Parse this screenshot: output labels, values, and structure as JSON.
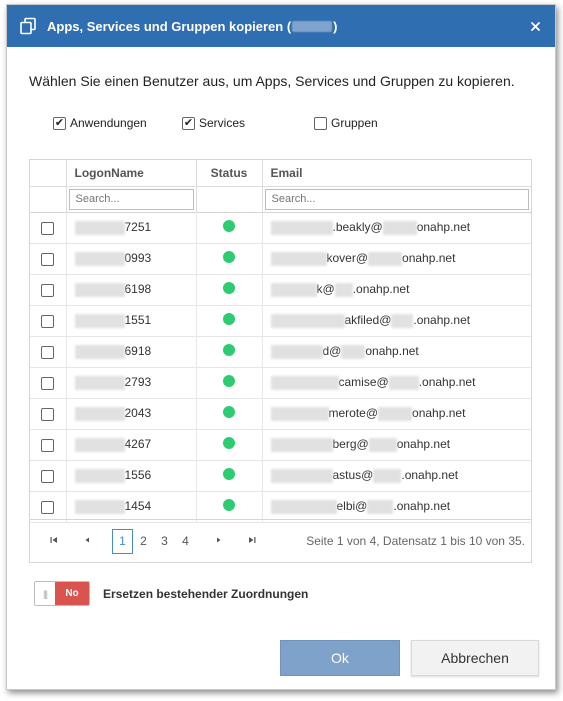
{
  "dialog": {
    "title": "Apps, Services und Gruppen kopieren (",
    "title_suffix": ")",
    "instruction": "Wählen Sie einen Benutzer aus, um Apps, Services und Gruppen zu kopieren."
  },
  "options": [
    {
      "label": "Anwendungen",
      "checked": true
    },
    {
      "label": "Services",
      "checked": true
    },
    {
      "label": "Gruppen",
      "checked": false
    }
  ],
  "grid": {
    "columns": [
      "LogonName",
      "Status",
      "Email"
    ],
    "search_placeholder": "Search...",
    "rows": [
      {
        "logon_suffix": "7251",
        "status": "green",
        "email_suffix": ".beakly@",
        "domain": "onahp.net"
      },
      {
        "logon_suffix": "0993",
        "status": "green",
        "email_suffix": "kover@",
        "domain": "onahp.net"
      },
      {
        "logon_suffix": "6198",
        "status": "green",
        "email_suffix": "k@",
        "domain": ".onahp.net"
      },
      {
        "logon_suffix": "1551",
        "status": "green",
        "email_suffix": "akfiled@",
        "domain": ".onahp.net"
      },
      {
        "logon_suffix": "6918",
        "status": "green",
        "email_suffix": "d@",
        "domain": "onahp.net"
      },
      {
        "logon_suffix": "2793",
        "status": "green",
        "email_suffix": "camise@",
        "domain": ".onahp.net"
      },
      {
        "logon_suffix": "2043",
        "status": "green",
        "email_suffix": "merote@",
        "domain": "onahp.net"
      },
      {
        "logon_suffix": "4267",
        "status": "green",
        "email_suffix": "berg@",
        "domain": "onahp.net"
      },
      {
        "logon_suffix": "1556",
        "status": "green",
        "email_suffix": "astus@",
        "domain": ".onahp.net"
      },
      {
        "logon_suffix": "1454",
        "status": "green",
        "email_suffix": "elbi@",
        "domain": ".onahp.net"
      }
    ]
  },
  "pager": {
    "pages": [
      "1",
      "2",
      "3",
      "4"
    ],
    "current_page": "1",
    "info": "Seite 1 von 4, Datensatz 1 bis 10 von 35."
  },
  "toggle": {
    "value": "No",
    "label": "Ersetzen bestehender Zuordnungen"
  },
  "buttons": {
    "ok": "Ok",
    "cancel": "Abbrechen"
  },
  "colors": {
    "titlebar": "#2f6eb0",
    "status_green": "#2ecc71",
    "toggle_no": "#d9534f",
    "ok_button": "#7ea2c9"
  }
}
